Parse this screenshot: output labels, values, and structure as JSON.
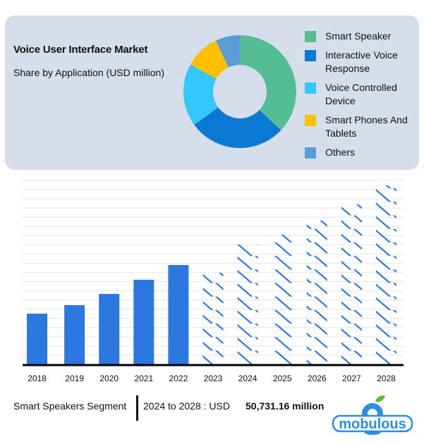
{
  "donut_card": {
    "title": "Voice User Interface Market",
    "subtitle": "Share by Application (USD million)"
  },
  "footer": {
    "segment_label": "Smart Speakers Segment",
    "range_label": "2024 to 2028 : USD",
    "value_label": "50,731.16 million",
    "logo_text": "mobulous"
  },
  "chart_data": [
    {
      "type": "pie",
      "variant": "donut",
      "title": "Voice User Interface Market",
      "subtitle": "Share by Application (USD million)",
      "legend_position": "right",
      "start_angle_deg": 0,
      "direction": "clockwise",
      "slices": [
        {
          "label": "Smart Speaker",
          "value": 37,
          "color": "#54bd94"
        },
        {
          "label": "Interactive Voice Response",
          "value": 28,
          "color": "#0b79d3"
        },
        {
          "label": "Voice Controlled Device",
          "value": 18,
          "color": "#33c7fb"
        },
        {
          "label": "Smart Phones And Tablets",
          "value": 10,
          "color": "#fec000"
        },
        {
          "label": "Others",
          "value": 7,
          "color": "#5b9bd6"
        }
      ]
    },
    {
      "type": "bar",
      "title": "",
      "xlabel": "",
      "ylabel": "",
      "y_units": "relative (no axis values shown)",
      "ylim": [
        0,
        100
      ],
      "grid": true,
      "categories": [
        "2018",
        "2019",
        "2020",
        "2021",
        "2022",
        "2023",
        "2024",
        "2025",
        "2026",
        "2027",
        "2028"
      ],
      "values": [
        27.6,
        32.2,
        38.3,
        46.0,
        54.0,
        49.8,
        65.1,
        70.5,
        78.2,
        87.0,
        97.3
      ],
      "styles": [
        "solid",
        "solid",
        "solid",
        "solid",
        "solid",
        "hatched",
        "hatched",
        "hatched",
        "hatched",
        "hatched",
        "hatched"
      ],
      "color": "#2a78e0",
      "grid_color": "#eaeaea",
      "axis_color": "#000000"
    }
  ]
}
